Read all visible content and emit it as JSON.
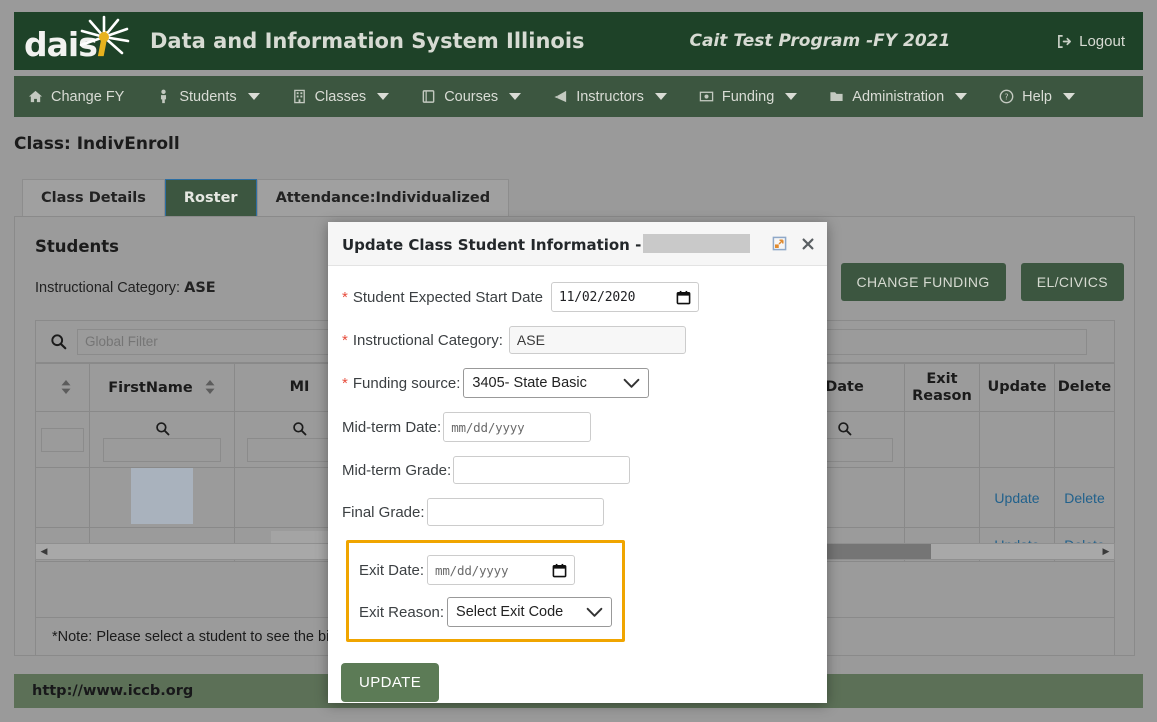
{
  "header": {
    "logo_text": "dais",
    "logo_italic_i": "i",
    "title": "Data and Information System Illinois",
    "program": "Cait Test Program -FY 2021",
    "logout": "Logout"
  },
  "nav": {
    "items": [
      {
        "label": "Change FY",
        "icon": "home-icon",
        "caret": false
      },
      {
        "label": "Students",
        "icon": "person-icon",
        "caret": true
      },
      {
        "label": "Classes",
        "icon": "building-icon",
        "caret": true
      },
      {
        "label": "Courses",
        "icon": "book-icon",
        "caret": true
      },
      {
        "label": "Instructors",
        "icon": "megaphone-icon",
        "caret": true
      },
      {
        "label": "Funding",
        "icon": "money-icon",
        "caret": true
      },
      {
        "label": "Administration",
        "icon": "folder-icon",
        "caret": true
      },
      {
        "label": "Help",
        "icon": "question-icon",
        "caret": true
      }
    ]
  },
  "page": {
    "title": "Class: IndivEnroll",
    "tabs": [
      {
        "label": "Class Details",
        "active": false
      },
      {
        "label": "Roster",
        "active": true
      },
      {
        "label": "Attendance:Individualized",
        "active": false
      }
    ]
  },
  "students_panel": {
    "heading": "Students",
    "instructional_category_label": "Instructional Category:",
    "instructional_category_value": "ASE",
    "buttons": [
      {
        "label": "CHANGE FUNDING"
      },
      {
        "label": "EL/CIVICS"
      }
    ],
    "global_filter_placeholder": "Global Filter",
    "note": "*Note: Please select a student to see the biod",
    "columns": [
      "",
      "FirstName",
      "MI",
      "Date",
      "Exit Reason",
      "Update",
      "Delete"
    ],
    "rows": [
      {
        "first_name": "",
        "mi": "",
        "date": "",
        "exit_reason": "",
        "update": "Update",
        "delete": "Delete"
      },
      {
        "first_name": "",
        "mi": "",
        "date": "",
        "exit_reason": "",
        "update": "Update",
        "delete": "Delete"
      }
    ]
  },
  "modal": {
    "title": "Update Class Student Information -",
    "maximize_icon": "maximize-icon",
    "close_icon": "close-icon",
    "fields": {
      "start_date_label": "Student Expected Start Date",
      "start_date_value": "11/02/2020",
      "instructional_category_label": "Instructional Category:",
      "instructional_category_value": "ASE",
      "funding_source_label": "Funding source:",
      "funding_source_value": "3405- State Basic",
      "midterm_date_label": "Mid-term Date:",
      "midterm_date_placeholder": "mm/dd/yyyy",
      "midterm_grade_label": "Mid-term Grade:",
      "midterm_grade_value": "",
      "final_grade_label": "Final Grade:",
      "final_grade_value": "",
      "exit_date_label": "Exit Date:",
      "exit_date_placeholder": "mm/dd/yyyy",
      "exit_reason_label": "Exit Reason:",
      "exit_reason_value": "Select Exit Code"
    },
    "update_button": "UPDATE",
    "highlight_color": "#f0a500"
  },
  "footer": {
    "url": "http://www.iccb.org"
  },
  "colors": {
    "header_green": "#1e4228",
    "nav_green": "#3c5640",
    "footer_green": "#5c7057",
    "accent_gold": "#e8b21e",
    "link_blue": "#21618c"
  }
}
